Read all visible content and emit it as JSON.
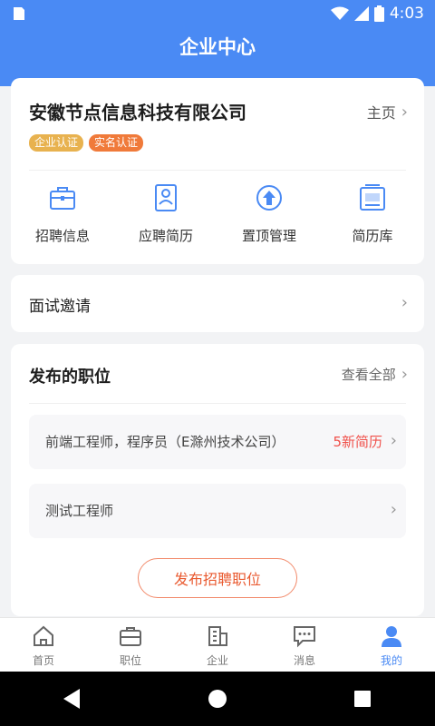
{
  "status_bar": {
    "time": "4:03"
  },
  "header": {
    "title": "企业中心"
  },
  "company": {
    "name": "安徽节点信息科技有限公司",
    "homepage_label": "主页",
    "badges": [
      "企业认证",
      "实名认证"
    ]
  },
  "quick_actions": [
    {
      "label": "招聘信息",
      "icon": "briefcase-icon"
    },
    {
      "label": "应聘简历",
      "icon": "resume-icon"
    },
    {
      "label": "置顶管理",
      "icon": "top-arrow-icon"
    },
    {
      "label": "简历库",
      "icon": "resume-library-icon"
    }
  ],
  "interview": {
    "label": "面试邀请"
  },
  "jobs": {
    "title": "发布的职位",
    "view_all_label": "查看全部",
    "items": [
      {
        "name": "前端工程师，程序员（E滁州技术公司）",
        "count": "5新简历"
      },
      {
        "name": "测试工程师",
        "count": ""
      }
    ],
    "publish_label": "发布招聘职位"
  },
  "bottom_nav": {
    "active_index": 4,
    "items": [
      {
        "label": "首页",
        "icon": "home-icon"
      },
      {
        "label": "职位",
        "icon": "briefcase-icon"
      },
      {
        "label": "企业",
        "icon": "building-icon"
      },
      {
        "label": "消息",
        "icon": "message-icon"
      },
      {
        "label": "我的",
        "icon": "user-icon"
      }
    ]
  },
  "colors": {
    "primary": "#4a8af4",
    "accent": "#e95a30",
    "badge_enterprise": "#e8b24f",
    "badge_real": "#f07a3a",
    "new_count": "#f0504a"
  }
}
